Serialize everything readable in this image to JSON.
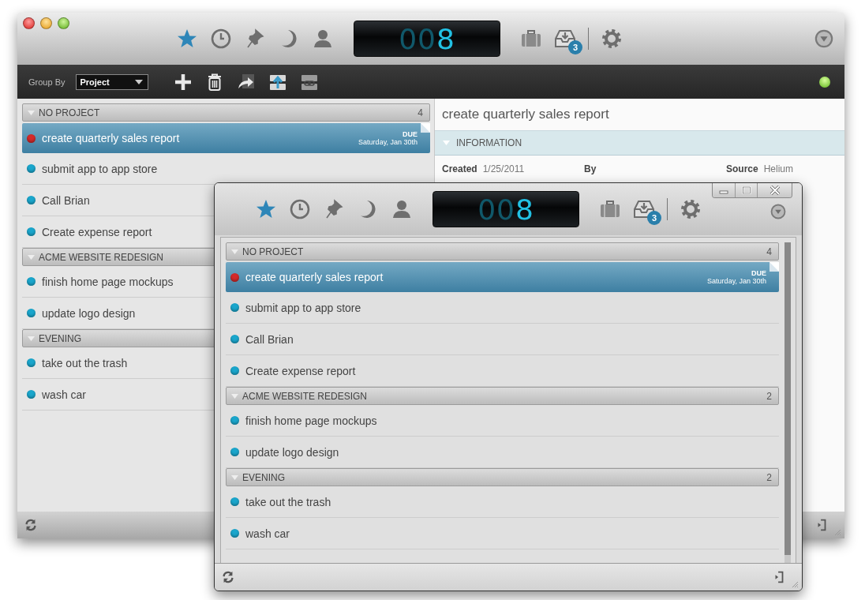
{
  "windows": [
    {
      "kind": "main",
      "title_bar": {
        "views": [
          {
            "kind": "star",
            "selected": true
          },
          {
            "kind": "clock",
            "selected": false
          },
          {
            "kind": "pin",
            "selected": false
          },
          {
            "kind": "moon",
            "selected": false
          },
          {
            "kind": "person",
            "selected": false
          }
        ],
        "counter": {
          "dim": "00",
          "lit": "8"
        },
        "inbox_badge": "3"
      },
      "toolbar": {
        "group_by_label": "Group By",
        "group_by_value": "Project",
        "online": true
      },
      "groups": [
        {
          "name": "NO PROJECT",
          "count": "4",
          "tasks": [
            {
              "title": "create quarterly sales report",
              "color": "#d42a2a",
              "selected": true,
              "due_label": "DUE",
              "due_date": "Saturday, Jan 30th"
            },
            {
              "title": "submit app to app store",
              "color": "#1aa6cc",
              "selected": false
            },
            {
              "title": "Call Brian",
              "color": "#1aa6cc",
              "selected": false
            },
            {
              "title": "Create expense report",
              "color": "#1aa6cc",
              "selected": false
            }
          ]
        },
        {
          "name": "ACME WEBSITE REDESIGN",
          "tasks": [
            {
              "title": "finish home page mockups",
              "color": "#1aa6cc",
              "selected": false
            },
            {
              "title": "update logo design",
              "color": "#1aa6cc",
              "selected": false
            }
          ]
        },
        {
          "name": "EVENING",
          "tasks": [
            {
              "title": "take out the trash",
              "color": "#1aa6cc",
              "selected": false
            },
            {
              "title": "wash car",
              "color": "#1aa6cc",
              "selected": false
            }
          ]
        }
      ],
      "detail": {
        "title": "create quarterly sales report",
        "section": "INFORMATION",
        "fields": [
          {
            "label": "Created",
            "value": "1/25/2011"
          },
          {
            "label": "By"
          },
          {
            "label": "Source",
            "value": "Helium"
          }
        ]
      }
    },
    {
      "kind": "mini",
      "title_bar": {
        "views": [
          {
            "kind": "star",
            "selected": true
          },
          {
            "kind": "clock",
            "selected": false
          },
          {
            "kind": "pin",
            "selected": false
          },
          {
            "kind": "moon",
            "selected": false
          },
          {
            "kind": "person",
            "selected": false
          }
        ],
        "counter": {
          "dim": "00",
          "lit": "8"
        },
        "inbox_badge": "3"
      },
      "groups": [
        {
          "name": "NO PROJECT",
          "count": "4",
          "tasks": [
            {
              "title": "create quarterly sales report",
              "color": "#d42a2a",
              "selected": true,
              "due_label": "DUE",
              "due_date": "Saturday, Jan 30th"
            },
            {
              "title": "submit app to app store",
              "color": "#1aa6cc",
              "selected": false
            },
            {
              "title": "Call Brian",
              "color": "#1aa6cc",
              "selected": false
            },
            {
              "title": "Create expense report",
              "color": "#1aa6cc",
              "selected": false
            }
          ]
        },
        {
          "name": "ACME WEBSITE REDESIGN",
          "count": "2",
          "tasks": [
            {
              "title": "finish home page mockups",
              "color": "#1aa6cc",
              "selected": false
            },
            {
              "title": "update logo design",
              "color": "#1aa6cc",
              "selected": false
            }
          ]
        },
        {
          "name": "EVENING",
          "count": "2",
          "tasks": [
            {
              "title": "take out the trash",
              "color": "#1aa6cc",
              "selected": false
            },
            {
              "title": "wash car",
              "color": "#1aa6cc",
              "selected": false
            }
          ]
        }
      ]
    }
  ]
}
